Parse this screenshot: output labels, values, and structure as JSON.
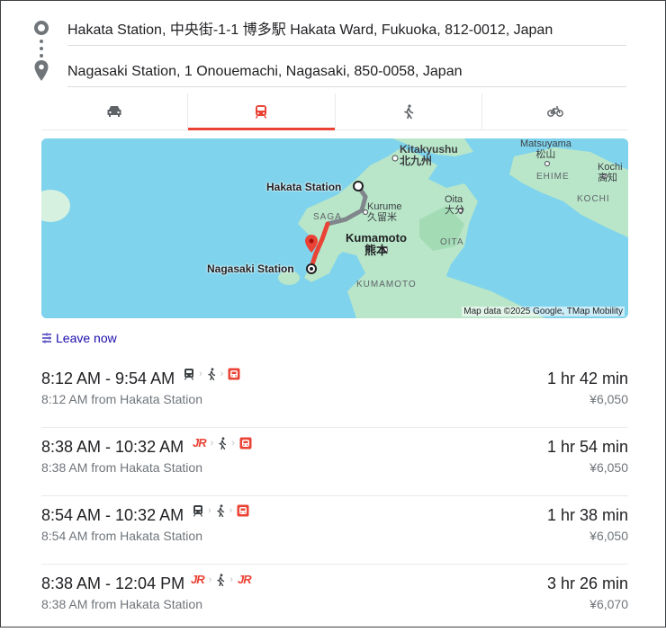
{
  "directions": {
    "origin": "Hakata Station, 中央街-1-1 博多駅 Hakata Ward, Fukuoka, 812-0012, Japan",
    "destination": "Nagasaki Station, 1 Onouemachi, Nagasaki, 850-0058, Japan"
  },
  "modes": [
    {
      "name": "car-icon",
      "active": false
    },
    {
      "name": "train-icon",
      "active": true
    },
    {
      "name": "walk-icon",
      "active": false
    },
    {
      "name": "bike-icon",
      "active": false
    }
  ],
  "map": {
    "labels": {
      "hakata": "Hakata Station",
      "nagasaki": "Nagasaki Station",
      "kitakyushu": "Kitakyushu",
      "kitakyushu_jp": "北九州",
      "kumamoto": "Kumamoto",
      "kumamoto_jp": "熊本",
      "kurume": "Kurume",
      "kurume_jp": "久留米",
      "oita": "Oita",
      "oita_jp": "大分",
      "saga": "SAGA",
      "oita_pref": "OITA",
      "kumamoto_pref": "KUMAMOTO",
      "matsuyama": "Matsuyama",
      "matsuyama_jp": "松山",
      "ehime": "EHIME",
      "kochi": "Kochi",
      "kochi_jp": "高知",
      "kochi_pref": "KOCHI"
    },
    "attribution": "Map data ©2025 Google, TMap Mobility",
    "colors": {
      "water": "#7fd3ec",
      "land": "#b9e6c9",
      "route": "#ea4335"
    }
  },
  "leave_now": "Leave now",
  "trips": [
    {
      "time": "8:12 AM - 9:54 AM",
      "from": "8:12 AM from Hakata Station",
      "duration": "1 hr 42 min",
      "price": "¥6,050"
    },
    {
      "time": "8:38 AM - 10:32 AM",
      "from": "8:38 AM from Hakata Station",
      "duration": "1 hr 54 min",
      "price": "¥6,050"
    },
    {
      "time": "8:54 AM - 10:32 AM",
      "from": "8:54 AM from Hakata Station",
      "duration": "1 hr 38 min",
      "price": "¥6,050"
    },
    {
      "time": "8:38 AM - 12:04 PM",
      "from": "8:38 AM from Hakata Station",
      "duration": "3 hr 26 min",
      "price": "¥6,070"
    }
  ],
  "jr_label": "JR"
}
